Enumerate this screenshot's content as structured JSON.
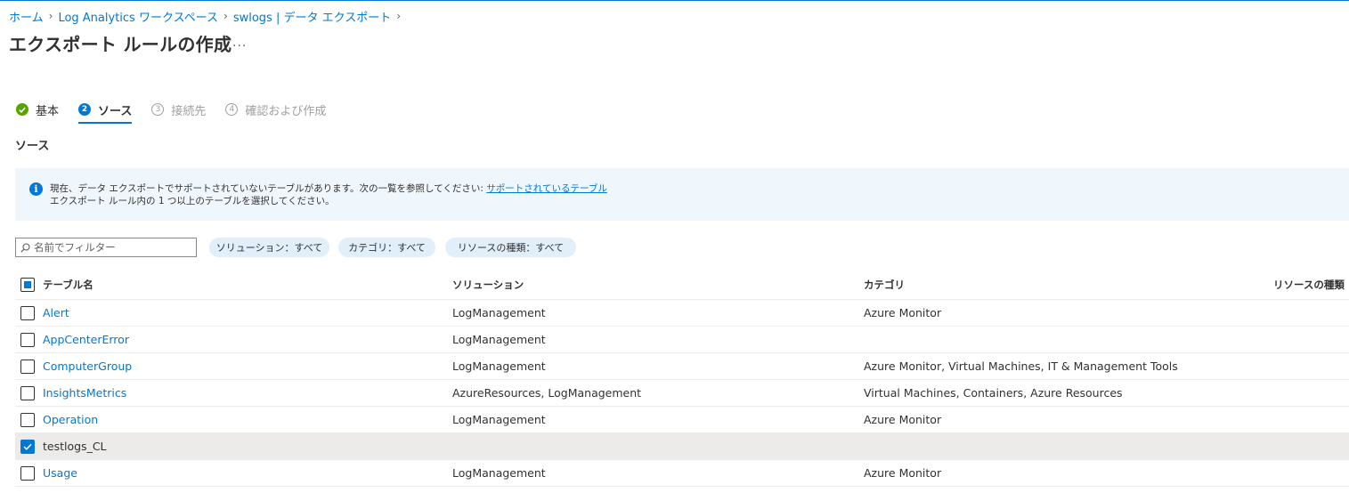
{
  "breadcrumb": {
    "items": [
      "ホーム",
      "Log Analytics ワークスペース",
      "swlogs | データ エクスポート"
    ]
  },
  "page": {
    "title": "エクスポート ルールの作成",
    "more_label": "..."
  },
  "steps": [
    {
      "label": "基本",
      "state": "done",
      "marker": ""
    },
    {
      "label": "ソース",
      "state": "current",
      "marker": "2"
    },
    {
      "label": "接続先",
      "state": "future",
      "marker": "3"
    },
    {
      "label": "確認および作成",
      "state": "future",
      "marker": "4"
    }
  ],
  "section": {
    "title": "ソース"
  },
  "info": {
    "icon": "i",
    "line1": "現在、データ エクスポートでサポートされていないテーブルがあります。次の一覧を参照してください: ",
    "link": "サポートされているテーブル",
    "line2": "エクスポート ルール内の 1 つ以上のテーブルを選択してください。"
  },
  "filters": {
    "search_placeholder": "名前でフィルター",
    "solution": "ソリューション：すべて",
    "category": "カテゴリ：すべて",
    "resource_type": "リソースの種類：すべて"
  },
  "table": {
    "columns": [
      "テーブル名",
      "ソリューション",
      "カテゴリ",
      "リソースの種類"
    ],
    "rows": [
      {
        "name": "Alert",
        "solution": "LogManagement",
        "category": "Azure Monitor",
        "resource_type": "",
        "checked": false
      },
      {
        "name": "AppCenterError",
        "solution": "LogManagement",
        "category": "",
        "resource_type": "",
        "checked": false
      },
      {
        "name": "ComputerGroup",
        "solution": "LogManagement",
        "category": "Azure Monitor, Virtual Machines, IT & Management Tools",
        "resource_type": "",
        "checked": false
      },
      {
        "name": "InsightsMetrics",
        "solution": "AzureResources, LogManagement",
        "category": "Virtual Machines, Containers, Azure Resources",
        "resource_type": "",
        "checked": false
      },
      {
        "name": "Operation",
        "solution": "LogManagement",
        "category": "Azure Monitor",
        "resource_type": "",
        "checked": false
      },
      {
        "name": "testlogs_CL",
        "solution": "",
        "category": "",
        "resource_type": "",
        "checked": true
      },
      {
        "name": "Usage",
        "solution": "LogManagement",
        "category": "Azure Monitor",
        "resource_type": "",
        "checked": false
      }
    ]
  },
  "colors": {
    "accent": "#0078d4",
    "success": "#57a300",
    "banner_bg": "#eff6fc",
    "pill_bg": "#e1effa",
    "selected_row_bg": "#edebe9"
  }
}
